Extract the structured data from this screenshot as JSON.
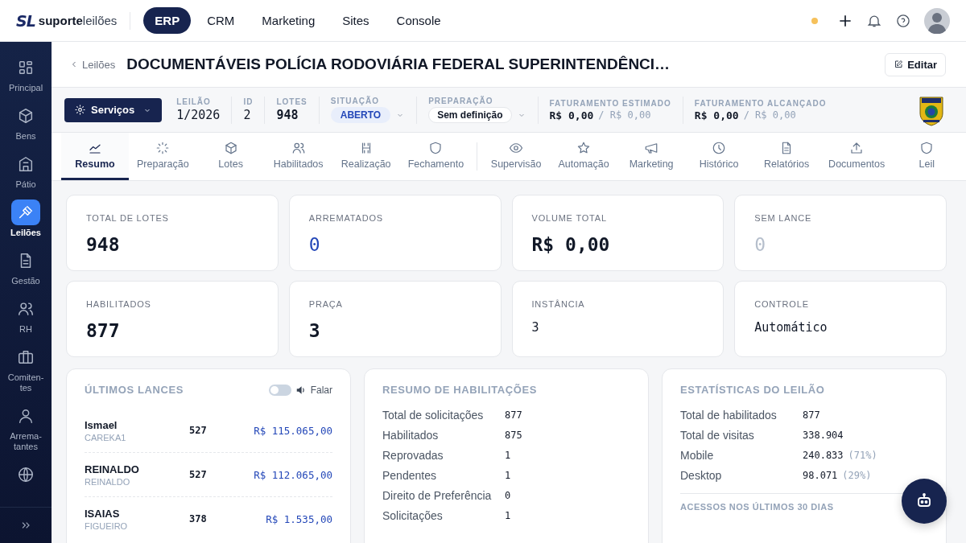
{
  "logo": {
    "mark": "SL",
    "strong": "suporte",
    "light": "leilões"
  },
  "top_nav": [
    {
      "label": "ERP",
      "selected": true
    },
    {
      "label": "CRM",
      "selected": false
    },
    {
      "label": "Marketing",
      "selected": false
    },
    {
      "label": "Sites",
      "selected": false
    },
    {
      "label": "Console",
      "selected": false
    }
  ],
  "sidebar": {
    "items": [
      {
        "label": "Principal",
        "selected": false
      },
      {
        "label": "Bens",
        "selected": false
      },
      {
        "label": "Pátio",
        "selected": false
      },
      {
        "label": "Leilões",
        "selected": true
      },
      {
        "label": "Gestão",
        "selected": false
      },
      {
        "label": "RH",
        "selected": false
      },
      {
        "label": "Comiten-tes",
        "selected": false
      },
      {
        "label": "Arrema-tantes",
        "selected": false
      },
      {
        "selected": false
      }
    ]
  },
  "breadcrumb": "Leilões",
  "title": "DOCUMENTÁVEIS POLÍCIA RODOVIÁRIA FEDERAL SUPERINTENDÊNCI…",
  "edit_button": "Editar",
  "services_button": "Serviços",
  "info": {
    "leilao": {
      "label": "LEILÃO",
      "value": "1/2026"
    },
    "id": {
      "label": "ID",
      "value": "2"
    },
    "lotes": {
      "label": "LOTES",
      "value": "948"
    },
    "situacao": {
      "label": "SITUAÇÃO",
      "value": "ABERTO"
    },
    "preparacao": {
      "label": "PREPARAÇÃO",
      "value": "Sem definição"
    },
    "faturamento": [
      {
        "label": "FATURAMENTO ESTIMADO",
        "value": "R$ 0,00",
        "total": "/ R$ 0,00"
      },
      {
        "label": "FATURAMENTO ALCANÇADO",
        "value": "R$ 0,00",
        "total": "/ R$ 0,00"
      }
    ]
  },
  "tabs": [
    {
      "label": "Resumo",
      "selected": true
    },
    {
      "label": "Preparação",
      "selected": false
    },
    {
      "label": "Lotes",
      "selected": false
    },
    {
      "label": "Habilitados",
      "selected": false
    },
    {
      "label": "Realização",
      "selected": false
    },
    {
      "label": "Fechamento",
      "selected": false
    },
    {
      "label": "Supervisão",
      "selected": false
    },
    {
      "label": "Automação",
      "selected": false
    },
    {
      "label": "Marketing",
      "selected": false
    },
    {
      "label": "Histórico",
      "selected": false
    },
    {
      "label": "Relatórios",
      "selected": false
    },
    {
      "label": "Documentos",
      "selected": false
    },
    {
      "label": "Leil",
      "selected": false
    }
  ],
  "stat_cards": [
    {
      "label": "TOTAL DE LOTES",
      "value": "948",
      "kind": "large"
    },
    {
      "label": "ARREMATADOS",
      "value": "0",
      "kind": "accent"
    },
    {
      "label": "VOLUME TOTAL",
      "value": "R$ 0,00",
      "kind": "large"
    },
    {
      "label": "SEM LANCE",
      "value": "0",
      "kind": "muted"
    },
    {
      "label": "HABILITADOS",
      "value": "877",
      "kind": "large"
    },
    {
      "label": "PRAÇA",
      "value": "3",
      "kind": "large"
    },
    {
      "label": "INSTÂNCIA",
      "value": "3",
      "kind": "small"
    },
    {
      "label": "CONTROLE",
      "value": "Automático",
      "kind": "small"
    }
  ],
  "lances": {
    "title": "ÚLTIMOS LANCES",
    "speak": {
      "label": "Falar",
      "on": false
    },
    "rows": [
      {
        "name": "Ismael",
        "user": "CAREKA1",
        "lot": "527",
        "amount": "R$ 115.065,00"
      },
      {
        "name": "REINALDO",
        "user": "REINALDO",
        "lot": "527",
        "amount": "R$ 112.065,00"
      },
      {
        "name": "ISAIAS",
        "user": "FIGUEIRO",
        "lot": "378",
        "amount": "R$ 1.535,00"
      }
    ]
  },
  "habilitacoes": {
    "title": "RESUMO DE HABILITAÇÕES",
    "rows": [
      {
        "label": "Total de solicitações",
        "value": "877"
      },
      {
        "label": "Habilitados",
        "value": "875"
      },
      {
        "label": "Reprovadas",
        "value": "1"
      },
      {
        "label": "Pendentes",
        "value": "1"
      },
      {
        "label": "Direito de Preferência",
        "value": "0"
      },
      {
        "label": "Solicitações",
        "value": "1"
      }
    ]
  },
  "estatisticas": {
    "title": "ESTATÍSTICAS DO LEILÃO",
    "rows": [
      {
        "label": "Total de habilitados",
        "value": "877"
      },
      {
        "label": "Total de visitas",
        "value": "338.904"
      },
      {
        "label": "Mobile",
        "value": "240.833",
        "share": "(71%)"
      },
      {
        "label": "Desktop",
        "value": "98.071",
        "share": "(29%)"
      }
    ],
    "section_title": "ACESSOS NOS ÚLTIMOS 30 DIAS"
  }
}
